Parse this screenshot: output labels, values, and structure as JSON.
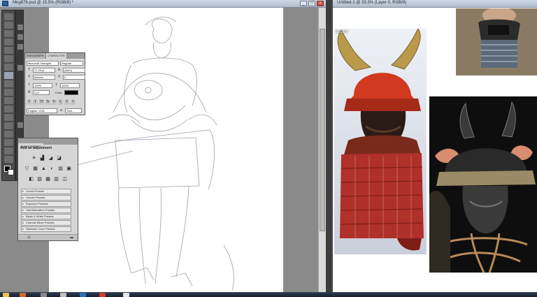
{
  "photoshop_window": {
    "title": "Mng876.psd @ 15.5% (RGB/8) *",
    "window_buttons": [
      "_",
      "□",
      "×"
    ]
  },
  "character_panel": {
    "tabs": [
      "PARAGRAPH",
      "CHARACTER"
    ],
    "font_family": "Microsoft Zhengrie",
    "font_style": "Regular",
    "font_size": "17.29 pt",
    "leading": "(Auto)",
    "kerning": "Metrics",
    "tracking": "0",
    "vertical_scale": "100%",
    "horizontal_scale": "100%",
    "baseline_shift": "0 pt",
    "color_label": "Color:",
    "format_buttons": [
      "T",
      "T",
      "TT",
      "Tr",
      "T¹",
      "T,",
      "T",
      "T"
    ],
    "language": "English: USA",
    "antialias": "Smo..."
  },
  "adjustments_panel": {
    "tab": "ADJUSTMENTS",
    "heading": "Add an adjustment",
    "icon_row_1": [
      "☀",
      "▟",
      "◢",
      "◪"
    ],
    "icon_row_2": [
      "▽",
      "▦",
      "▲",
      "◐",
      "▨",
      "▣"
    ],
    "icon_row_3": [
      "◧",
      "▨",
      "▩",
      "▥",
      "◫"
    ],
    "presets": [
      "Levels Presets",
      "Curves Presets",
      "Exposure Presets",
      "Hue/Saturation Presets",
      "Black & White Presets",
      "Channel Mixer Presets",
      "Selective Color Presets"
    ]
  },
  "reference_window": {
    "title": "Untitled-1 @ 33.3% (Layer 0, RGB/8)",
    "url_fragment": "it.com/"
  },
  "colors": {
    "accent_red_armor": "#b0302a",
    "helmet_red": "#d13a1e",
    "horn_gold": "#b89a4a",
    "sketch_stroke": "#8a7a95"
  }
}
